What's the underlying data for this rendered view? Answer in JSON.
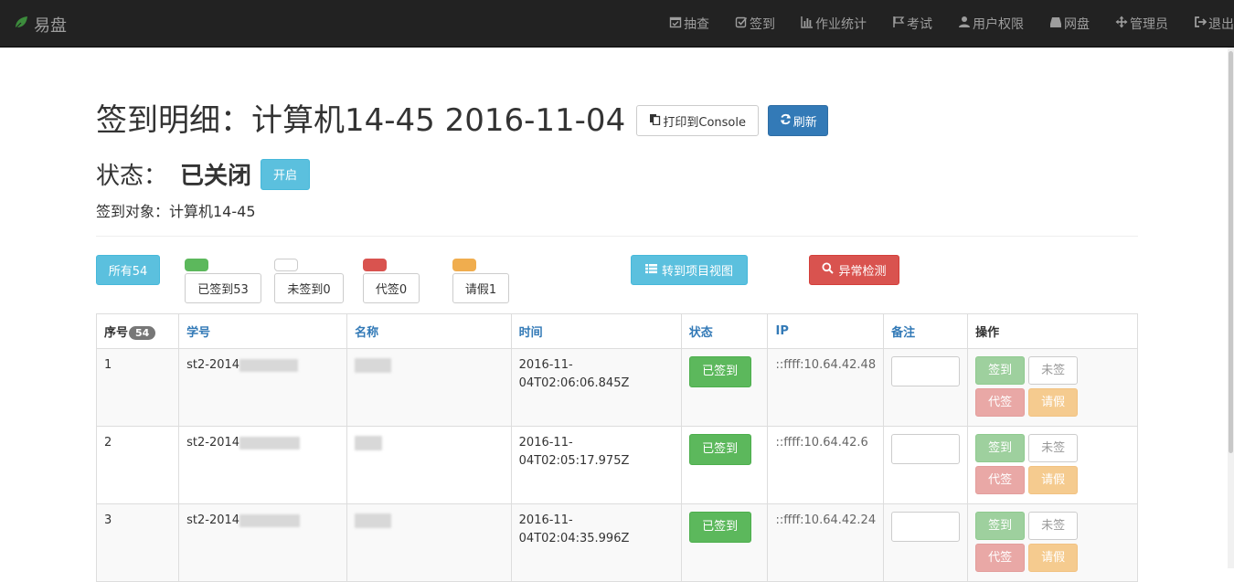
{
  "navbar": {
    "brand": "易盘",
    "items": [
      {
        "label": "抽查",
        "icon": "calendar-check-icon"
      },
      {
        "label": "签到",
        "icon": "check-square-icon"
      },
      {
        "label": "作业统计",
        "icon": "bar-chart-icon"
      },
      {
        "label": "考试",
        "icon": "flag-icon"
      },
      {
        "label": "用户权限",
        "icon": "user-icon"
      },
      {
        "label": "网盘",
        "icon": "hdd-icon"
      },
      {
        "label": "管理员",
        "icon": "move-icon"
      },
      {
        "label": "退出",
        "icon": "log-out-icon"
      }
    ]
  },
  "header": {
    "title": "签到明细：计算机14-45 2016-11-04",
    "print_button": "打印到Console",
    "refresh_button": "刷新",
    "status_label": "状态：",
    "status_value": "已关闭",
    "open_button": "开启",
    "target_line": "签到对象：计算机14-45"
  },
  "filters": {
    "all": "所有54",
    "signed": "已签到53",
    "unsigned": "未签到0",
    "proxy": "代签0",
    "leave": "请假1",
    "project_view": "转到项目视图",
    "anomaly": "异常检测",
    "colors": {
      "signed": "#5cb85c",
      "unsigned": "#ffffff",
      "proxy": "#d9534f",
      "leave": "#f0ad4e"
    }
  },
  "table": {
    "columns": {
      "index": "序号",
      "index_badge": "54",
      "student_id": "学号",
      "name": "名称",
      "time": "时间",
      "status": "状态",
      "ip": "IP",
      "note": "备注",
      "ops": "操作"
    },
    "actions": {
      "sign": "签到",
      "unsign": "未签",
      "proxy": "代签",
      "leave": "请假"
    },
    "rows": [
      {
        "index": "1",
        "id_prefix": "st2-2014",
        "time_line1": "2016-11-",
        "time_line2": "04T02:06:06.845Z",
        "status": "已签到",
        "ip": "::ffff:10.64.42.48"
      },
      {
        "index": "2",
        "id_prefix": "st2-2014",
        "time_line1": "2016-11-",
        "time_line2": "04T02:05:17.975Z",
        "status": "已签到",
        "ip": "::ffff:10.64.42.6"
      },
      {
        "index": "3",
        "id_prefix": "st2-2014",
        "time_line1": "2016-11-",
        "time_line2": "04T02:04:35.996Z",
        "status": "已签到",
        "ip": "::ffff:10.64.42.24"
      }
    ]
  }
}
